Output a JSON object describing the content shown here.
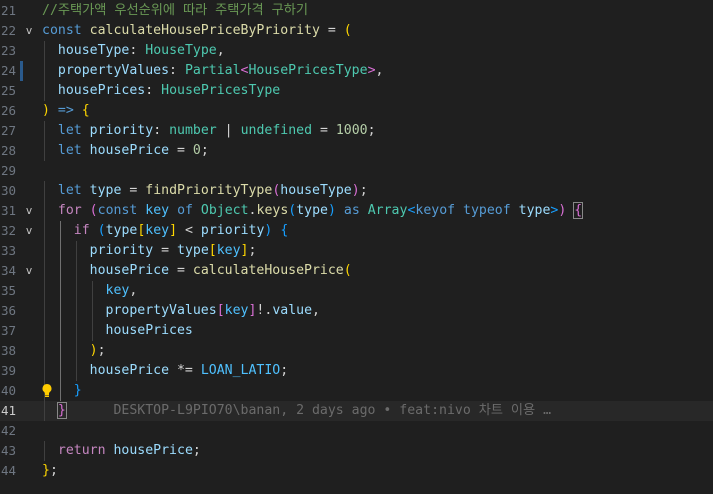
{
  "editor": {
    "theme_colors": {
      "background": "#1f1f1f",
      "comment": "#6a9955",
      "keyword": "#569cd6",
      "control": "#c586c0",
      "variable": "#9cdcfe",
      "function": "#dcdcaa",
      "type": "#4ec9b0",
      "number": "#b5cea8"
    },
    "lines": [
      {
        "number": "21",
        "tokens": [
          [
            "tk-comment",
            "//주택가액 우선순위에 따라 주택가격 구하기"
          ]
        ]
      },
      {
        "number": "22",
        "fold": "v",
        "tokens": [
          [
            "tk-kw",
            "const"
          ],
          [
            "tk-op",
            " "
          ],
          [
            "tk-func",
            "calculateHousePriceByPriority"
          ],
          [
            "tk-op",
            " = "
          ],
          [
            "tk-p1",
            "("
          ]
        ]
      },
      {
        "number": "23",
        "tokens": [
          [
            "tk-op",
            "  "
          ],
          [
            "tk-var",
            "houseType"
          ],
          [
            "tk-op",
            ": "
          ],
          [
            "tk-type",
            "HouseType"
          ],
          [
            "tk-op",
            ","
          ]
        ]
      },
      {
        "number": "24",
        "mark": true,
        "tokens": [
          [
            "tk-op",
            "  "
          ],
          [
            "tk-var",
            "propertyValues"
          ],
          [
            "tk-op",
            ": "
          ],
          [
            "tk-type",
            "Partial"
          ],
          [
            "tk-p2",
            "<"
          ],
          [
            "tk-type",
            "HousePricesType"
          ],
          [
            "tk-p2",
            ">"
          ],
          [
            "tk-op",
            ","
          ]
        ]
      },
      {
        "number": "25",
        "tokens": [
          [
            "tk-op",
            "  "
          ],
          [
            "tk-var",
            "housePrices"
          ],
          [
            "tk-op",
            ": "
          ],
          [
            "tk-type",
            "HousePricesType"
          ]
        ]
      },
      {
        "number": "26",
        "tokens": [
          [
            "tk-p1",
            ")"
          ],
          [
            "tk-op",
            " "
          ],
          [
            "tk-kw",
            "=>"
          ],
          [
            "tk-op",
            " "
          ],
          [
            "tk-p1",
            "{"
          ]
        ]
      },
      {
        "number": "27",
        "tokens": [
          [
            "tk-op",
            "  "
          ],
          [
            "tk-kw",
            "let"
          ],
          [
            "tk-op",
            " "
          ],
          [
            "tk-var",
            "priority"
          ],
          [
            "tk-op",
            ": "
          ],
          [
            "tk-type",
            "number"
          ],
          [
            "tk-op",
            " | "
          ],
          [
            "tk-type",
            "undefined"
          ],
          [
            "tk-op",
            " = "
          ],
          [
            "tk-num",
            "1000"
          ],
          [
            "tk-op",
            ";"
          ]
        ]
      },
      {
        "number": "28",
        "tokens": [
          [
            "tk-op",
            "  "
          ],
          [
            "tk-kw",
            "let"
          ],
          [
            "tk-op",
            " "
          ],
          [
            "tk-var",
            "housePrice"
          ],
          [
            "tk-op",
            " = "
          ],
          [
            "tk-num",
            "0"
          ],
          [
            "tk-op",
            ";"
          ]
        ]
      },
      {
        "number": "29",
        "tokens": []
      },
      {
        "number": "30",
        "tokens": [
          [
            "tk-op",
            "  "
          ],
          [
            "tk-kw",
            "let"
          ],
          [
            "tk-op",
            " "
          ],
          [
            "tk-var",
            "type"
          ],
          [
            "tk-op",
            " = "
          ],
          [
            "tk-func",
            "findPriorityType"
          ],
          [
            "tk-p2",
            "("
          ],
          [
            "tk-var",
            "houseType"
          ],
          [
            "tk-p2",
            ")"
          ],
          [
            "tk-op",
            ";"
          ]
        ]
      },
      {
        "number": "31",
        "fold": "v",
        "tokens": [
          [
            "tk-op",
            "  "
          ],
          [
            "tk-ctrl",
            "for"
          ],
          [
            "tk-op",
            " "
          ],
          [
            "tk-p2",
            "("
          ],
          [
            "tk-kw",
            "const"
          ],
          [
            "tk-op",
            " "
          ],
          [
            "tk-const",
            "key"
          ],
          [
            "tk-op",
            " "
          ],
          [
            "tk-kw",
            "of"
          ],
          [
            "tk-op",
            " "
          ],
          [
            "tk-type",
            "Object"
          ],
          [
            "tk-op",
            "."
          ],
          [
            "tk-func",
            "keys"
          ],
          [
            "tk-p3",
            "("
          ],
          [
            "tk-var",
            "type"
          ],
          [
            "tk-p3",
            ")"
          ],
          [
            "tk-op",
            " "
          ],
          [
            "tk-kw",
            "as"
          ],
          [
            "tk-op",
            " "
          ],
          [
            "tk-type",
            "Array"
          ],
          [
            "tk-p3",
            "<"
          ],
          [
            "tk-kw",
            "keyof"
          ],
          [
            "tk-op",
            " "
          ],
          [
            "tk-kw",
            "typeof"
          ],
          [
            "tk-op",
            " "
          ],
          [
            "tk-var",
            "type"
          ],
          [
            "tk-p3",
            ">"
          ],
          [
            "tk-p2",
            ")"
          ],
          [
            "tk-op",
            " "
          ],
          [
            "tk-p2 bracket-box",
            "{"
          ]
        ]
      },
      {
        "number": "32",
        "fold": "v",
        "tokens": [
          [
            "tk-op",
            "    "
          ],
          [
            "tk-ctrl",
            "if"
          ],
          [
            "tk-op",
            " "
          ],
          [
            "tk-p3",
            "("
          ],
          [
            "tk-var",
            "type"
          ],
          [
            "tk-p1",
            "["
          ],
          [
            "tk-const",
            "key"
          ],
          [
            "tk-p1",
            "]"
          ],
          [
            "tk-op",
            " < "
          ],
          [
            "tk-var",
            "priority"
          ],
          [
            "tk-p3",
            ")"
          ],
          [
            "tk-op",
            " "
          ],
          [
            "tk-p3",
            "{"
          ]
        ]
      },
      {
        "number": "33",
        "tokens": [
          [
            "tk-op",
            "      "
          ],
          [
            "tk-var",
            "priority"
          ],
          [
            "tk-op",
            " = "
          ],
          [
            "tk-var",
            "type"
          ],
          [
            "tk-p1",
            "["
          ],
          [
            "tk-const",
            "key"
          ],
          [
            "tk-p1",
            "]"
          ],
          [
            "tk-op",
            ";"
          ]
        ]
      },
      {
        "number": "34",
        "fold": "v",
        "tokens": [
          [
            "tk-op",
            "      "
          ],
          [
            "tk-var",
            "housePrice"
          ],
          [
            "tk-op",
            " = "
          ],
          [
            "tk-func",
            "calculateHousePrice"
          ],
          [
            "tk-p1",
            "("
          ]
        ]
      },
      {
        "number": "35",
        "tokens": [
          [
            "tk-op",
            "        "
          ],
          [
            "tk-const",
            "key"
          ],
          [
            "tk-op",
            ","
          ]
        ]
      },
      {
        "number": "36",
        "tokens": [
          [
            "tk-op",
            "        "
          ],
          [
            "tk-var",
            "propertyValues"
          ],
          [
            "tk-p2",
            "["
          ],
          [
            "tk-const",
            "key"
          ],
          [
            "tk-p2",
            "]"
          ],
          [
            "tk-op",
            "!."
          ],
          [
            "tk-var",
            "value"
          ],
          [
            "tk-op",
            ","
          ]
        ]
      },
      {
        "number": "37",
        "tokens": [
          [
            "tk-op",
            "        "
          ],
          [
            "tk-var",
            "housePrices"
          ]
        ]
      },
      {
        "number": "38",
        "tokens": [
          [
            "tk-op",
            "      "
          ],
          [
            "tk-p1",
            ")"
          ],
          [
            "tk-op",
            ";"
          ]
        ]
      },
      {
        "number": "39",
        "tokens": [
          [
            "tk-op",
            "      "
          ],
          [
            "tk-var",
            "housePrice"
          ],
          [
            "tk-op",
            " *= "
          ],
          [
            "tk-const",
            "LOAN_LATIO"
          ],
          [
            "tk-op",
            ";"
          ]
        ]
      },
      {
        "number": "40",
        "bulb": true,
        "tokens": [
          [
            "tk-op",
            "    "
          ],
          [
            "tk-p3",
            "}"
          ]
        ]
      },
      {
        "number": "41",
        "current": true,
        "tokens": [
          [
            "tk-op",
            "  "
          ],
          [
            "tk-p2 bracket-box",
            "}"
          ],
          [
            "tk-op",
            "      "
          ],
          [
            "tk-blame",
            "DESKTOP-L9PIO70\\banan, 2 days ago • feat:nivo 차트 이용 …"
          ]
        ]
      },
      {
        "number": "42",
        "tokens": []
      },
      {
        "number": "43",
        "tokens": [
          [
            "tk-op",
            "  "
          ],
          [
            "tk-ctrl",
            "return"
          ],
          [
            "tk-op",
            " "
          ],
          [
            "tk-var",
            "housePrice"
          ],
          [
            "tk-op",
            ";"
          ]
        ]
      },
      {
        "number": "44",
        "tokens": [
          [
            "tk-p1",
            "}"
          ],
          [
            "tk-op",
            ";"
          ]
        ]
      }
    ]
  }
}
